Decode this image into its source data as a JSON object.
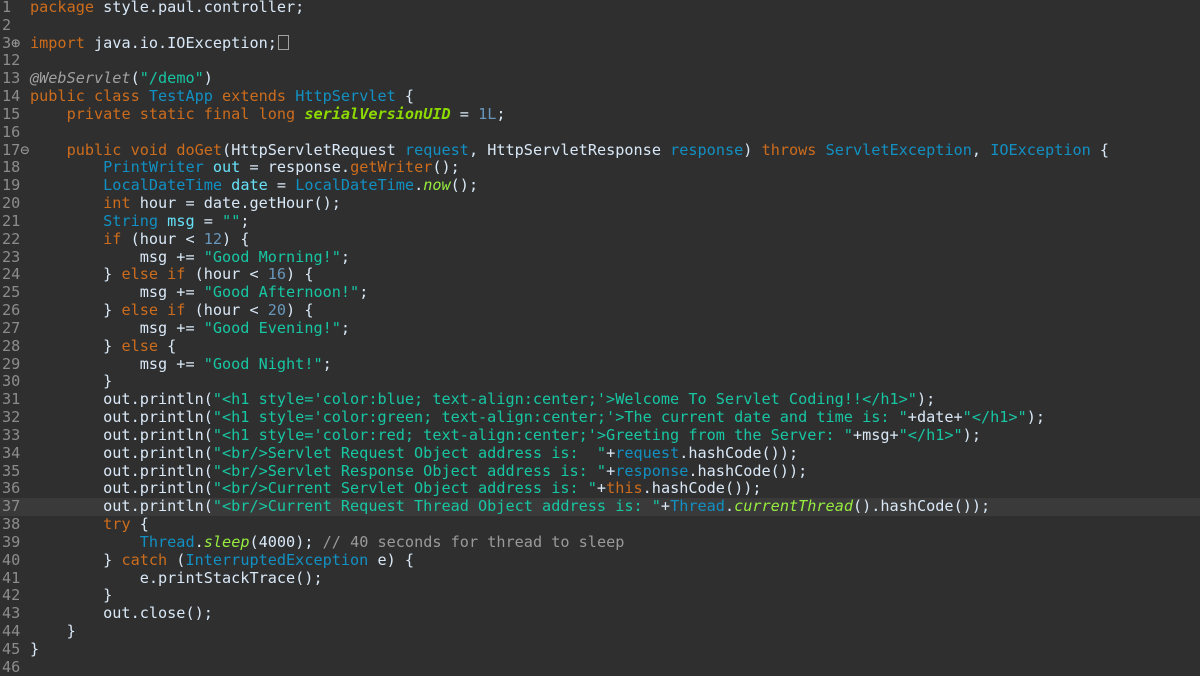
{
  "editor": {
    "colors": {
      "background": "#2f2f2f",
      "keyword": "#cc6c1d",
      "type": "#1290c3",
      "string": "#17c6a3",
      "number": "#6897bb",
      "comment": "#9a9a9a",
      "text": "#d9e8f7"
    },
    "lines": [
      {
        "num": "1",
        "marker": "",
        "tokens": [
          [
            "kw",
            "package"
          ],
          [
            "plain",
            " style.paul.controller;"
          ]
        ]
      },
      {
        "num": "2",
        "marker": "",
        "tokens": []
      },
      {
        "num": "3",
        "marker": "⊕",
        "tokens": [
          [
            "kw",
            "import"
          ],
          [
            "plain",
            " java.io.IOException;"
          ]
        ],
        "collapsed": true
      },
      {
        "num": "12",
        "marker": "",
        "tokens": []
      },
      {
        "num": "13",
        "marker": "",
        "tokens": [
          [
            "ann",
            "@WebServlet"
          ],
          [
            "plain",
            "("
          ],
          [
            "str",
            "\"/demo\""
          ],
          [
            "plain",
            ")"
          ]
        ]
      },
      {
        "num": "14",
        "marker": "",
        "tokens": [
          [
            "kw",
            "public class "
          ],
          [
            "type",
            "TestApp"
          ],
          [
            "kw",
            " extends "
          ],
          [
            "type",
            "HttpServlet"
          ],
          [
            "plain",
            " {"
          ]
        ]
      },
      {
        "num": "15",
        "marker": "",
        "tokens": [
          [
            "plain",
            "    "
          ],
          [
            "kw",
            "private static final long "
          ],
          [
            "const",
            "serialVersionUID"
          ],
          [
            "plain",
            " = "
          ],
          [
            "num",
            "1L"
          ],
          [
            "plain",
            ";"
          ]
        ]
      },
      {
        "num": "16",
        "marker": "",
        "tokens": []
      },
      {
        "num": "17",
        "marker": "⊖",
        "tokens": [
          [
            "plain",
            "    "
          ],
          [
            "kw",
            "public void "
          ],
          [
            "kw",
            "doGet"
          ],
          [
            "plain",
            "("
          ],
          [
            "plain",
            "HttpServletRequest "
          ],
          [
            "type",
            "request"
          ],
          [
            "plain",
            ", "
          ],
          [
            "plain",
            "HttpServletResponse "
          ],
          [
            "type",
            "response"
          ],
          [
            "plain",
            ") "
          ],
          [
            "kw",
            "throws "
          ],
          [
            "type",
            "ServletException"
          ],
          [
            "plain",
            ", "
          ],
          [
            "type",
            "IOException"
          ],
          [
            "plain",
            " {"
          ]
        ]
      },
      {
        "num": "18",
        "marker": "",
        "tokens": [
          [
            "plain",
            "        "
          ],
          [
            "type",
            "PrintWriter"
          ],
          [
            "fld",
            " out"
          ],
          [
            "plain",
            " = response."
          ],
          [
            "kw",
            "getWriter"
          ],
          [
            "plain",
            "();"
          ]
        ]
      },
      {
        "num": "19",
        "marker": "",
        "tokens": [
          [
            "plain",
            "        "
          ],
          [
            "type",
            "LocalDateTime"
          ],
          [
            "fld",
            " date"
          ],
          [
            "plain",
            " = "
          ],
          [
            "type",
            "LocalDateTime"
          ],
          [
            "plain",
            "."
          ],
          [
            "static",
            "now"
          ],
          [
            "plain",
            "();"
          ]
        ]
      },
      {
        "num": "20",
        "marker": "",
        "tokens": [
          [
            "plain",
            "        "
          ],
          [
            "kw",
            "int"
          ],
          [
            "plain",
            " hour = date.getHour();"
          ]
        ]
      },
      {
        "num": "21",
        "marker": "",
        "tokens": [
          [
            "plain",
            "        "
          ],
          [
            "type",
            "String"
          ],
          [
            "fld",
            " msg"
          ],
          [
            "plain",
            " = "
          ],
          [
            "str",
            "\"\""
          ],
          [
            "plain",
            ";"
          ]
        ]
      },
      {
        "num": "22",
        "marker": "",
        "tokens": [
          [
            "plain",
            "        "
          ],
          [
            "kw",
            "if"
          ],
          [
            "plain",
            " (hour < "
          ],
          [
            "num",
            "12"
          ],
          [
            "plain",
            ") {"
          ]
        ]
      },
      {
        "num": "23",
        "marker": "",
        "tokens": [
          [
            "plain",
            "            msg += "
          ],
          [
            "str",
            "\"Good Morning!\""
          ],
          [
            "plain",
            ";"
          ]
        ]
      },
      {
        "num": "24",
        "marker": "",
        "tokens": [
          [
            "plain",
            "        } "
          ],
          [
            "kw",
            "else if"
          ],
          [
            "plain",
            " (hour < "
          ],
          [
            "num",
            "16"
          ],
          [
            "plain",
            ") {"
          ]
        ]
      },
      {
        "num": "25",
        "marker": "",
        "tokens": [
          [
            "plain",
            "            msg += "
          ],
          [
            "str",
            "\"Good Afternoon!\""
          ],
          [
            "plain",
            ";"
          ]
        ]
      },
      {
        "num": "26",
        "marker": "",
        "tokens": [
          [
            "plain",
            "        } "
          ],
          [
            "kw",
            "else if"
          ],
          [
            "plain",
            " (hour < "
          ],
          [
            "num",
            "20"
          ],
          [
            "plain",
            ") {"
          ]
        ]
      },
      {
        "num": "27",
        "marker": "",
        "tokens": [
          [
            "plain",
            "            msg += "
          ],
          [
            "str",
            "\"Good Evening!\""
          ],
          [
            "plain",
            ";"
          ]
        ]
      },
      {
        "num": "28",
        "marker": "",
        "tokens": [
          [
            "plain",
            "        } "
          ],
          [
            "kw",
            "else"
          ],
          [
            "plain",
            " {"
          ]
        ]
      },
      {
        "num": "29",
        "marker": "",
        "tokens": [
          [
            "plain",
            "            msg += "
          ],
          [
            "str",
            "\"Good Night!\""
          ],
          [
            "plain",
            ";"
          ]
        ]
      },
      {
        "num": "30",
        "marker": "",
        "tokens": [
          [
            "plain",
            "        }"
          ]
        ]
      },
      {
        "num": "31",
        "marker": "",
        "tokens": [
          [
            "plain",
            "        out.println("
          ],
          [
            "str",
            "\"<h1 style='color:blue; text-align:center;'>Welcome To Servlet Coding!!</h1>\""
          ],
          [
            "plain",
            ");"
          ]
        ]
      },
      {
        "num": "32",
        "marker": "",
        "tokens": [
          [
            "plain",
            "        out.println("
          ],
          [
            "str",
            "\"<h1 style='color:green; text-align:center;'>The current date and time is: \""
          ],
          [
            "plain",
            "+date+"
          ],
          [
            "str",
            "\"</h1>\""
          ],
          [
            "plain",
            ");"
          ]
        ]
      },
      {
        "num": "33",
        "marker": "",
        "tokens": [
          [
            "plain",
            "        out.println("
          ],
          [
            "str",
            "\"<h1 style='color:red; text-align:center;'>Greeting from the Server: \""
          ],
          [
            "plain",
            "+msg+"
          ],
          [
            "str",
            "\"</h1>\""
          ],
          [
            "plain",
            ");"
          ]
        ]
      },
      {
        "num": "34",
        "marker": "",
        "tokens": [
          [
            "plain",
            "        out.println("
          ],
          [
            "str",
            "\"<br/>Servlet Request Object address is:  \""
          ],
          [
            "plain",
            "+"
          ],
          [
            "type",
            "request"
          ],
          [
            "plain",
            ".hashCode());"
          ]
        ]
      },
      {
        "num": "35",
        "marker": "",
        "tokens": [
          [
            "plain",
            "        out.println("
          ],
          [
            "str",
            "\"<br/>Servlet Response Object address is: \""
          ],
          [
            "plain",
            "+"
          ],
          [
            "type",
            "response"
          ],
          [
            "plain",
            ".hashCode());"
          ]
        ]
      },
      {
        "num": "36",
        "marker": "",
        "tokens": [
          [
            "plain",
            "        out.println("
          ],
          [
            "str",
            "\"<br/>Current Servlet Object address is: \""
          ],
          [
            "plain",
            "+"
          ],
          [
            "kw",
            "this"
          ],
          [
            "plain",
            ".hashCode());"
          ]
        ]
      },
      {
        "num": "37",
        "marker": "",
        "current": true,
        "tokens": [
          [
            "plain",
            "        out.println("
          ],
          [
            "str",
            "\"<br/>Current Request Thread Object address is: \""
          ],
          [
            "plain",
            "+"
          ],
          [
            "type",
            "Thread"
          ],
          [
            "plain",
            "."
          ],
          [
            "static",
            "currentThread"
          ],
          [
            "plain",
            "().hashCode());"
          ]
        ]
      },
      {
        "num": "38",
        "marker": "",
        "tokens": [
          [
            "plain",
            "        "
          ],
          [
            "kw",
            "try"
          ],
          [
            "plain",
            " {"
          ]
        ]
      },
      {
        "num": "39",
        "marker": "",
        "tokens": [
          [
            "plain",
            "            "
          ],
          [
            "type",
            "Thread"
          ],
          [
            "plain",
            "."
          ],
          [
            "static",
            "sleep"
          ],
          [
            "plain",
            "(4000); "
          ],
          [
            "cmt",
            "// 40 seconds for thread to sleep"
          ]
        ]
      },
      {
        "num": "40",
        "marker": "",
        "tokens": [
          [
            "plain",
            "        } "
          ],
          [
            "kw",
            "catch"
          ],
          [
            "plain",
            " ("
          ],
          [
            "type",
            "InterruptedException"
          ],
          [
            "plain",
            " e) {"
          ]
        ]
      },
      {
        "num": "41",
        "marker": "",
        "tokens": [
          [
            "plain",
            "            e.printStackTrace();"
          ]
        ]
      },
      {
        "num": "42",
        "marker": "",
        "tokens": [
          [
            "plain",
            "        }"
          ]
        ]
      },
      {
        "num": "43",
        "marker": "",
        "tokens": [
          [
            "plain",
            "        out.close();"
          ]
        ]
      },
      {
        "num": "44",
        "marker": "",
        "tokens": [
          [
            "plain",
            "    }"
          ]
        ]
      },
      {
        "num": "45",
        "marker": "",
        "tokens": [
          [
            "plain",
            "}"
          ]
        ]
      },
      {
        "num": "46",
        "marker": "",
        "tokens": []
      }
    ]
  }
}
